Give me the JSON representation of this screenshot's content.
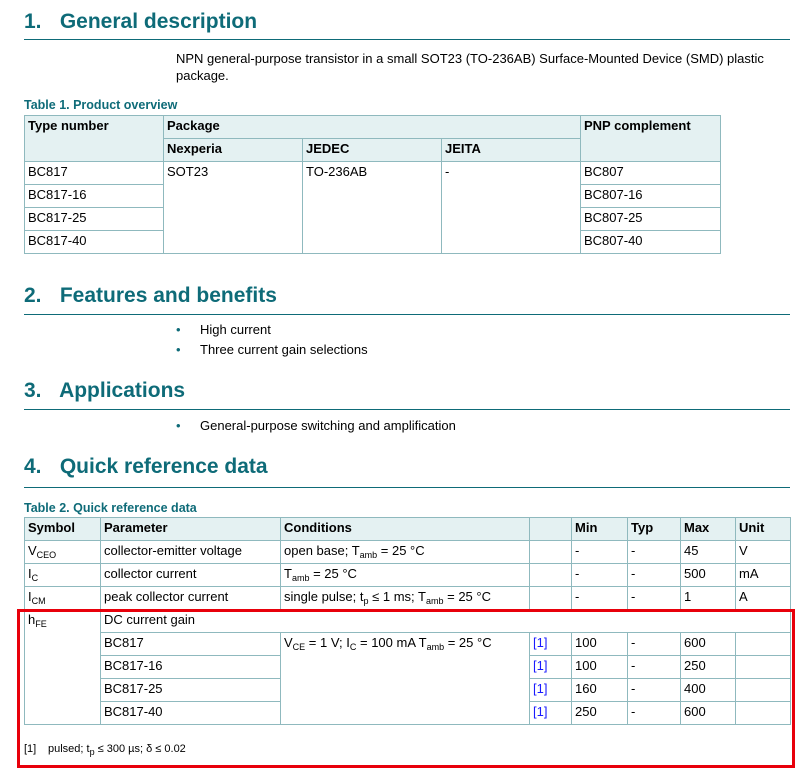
{
  "sections": [
    {
      "num": "1.",
      "title": "General description"
    },
    {
      "num": "2.",
      "title": "Features and benefits"
    },
    {
      "num": "3.",
      "title": "Applications"
    },
    {
      "num": "4.",
      "title": "Quick reference data"
    }
  ],
  "description": "NPN general-purpose transistor in a small SOT23 (TO-236AB) Surface-Mounted Device (SMD) plastic package.",
  "table1": {
    "caption": "Table 1. Product overview",
    "headers": {
      "type": "Type number",
      "package": "Package",
      "nexperia": "Nexperia",
      "jedec": "JEDEC",
      "jeita": "JEITA",
      "pnp": "PNP complement"
    },
    "package": {
      "nexperia": "SOT23",
      "jedec": "TO-236AB",
      "jeita": "-"
    },
    "rows": [
      {
        "type": "BC817",
        "pnp": "BC807"
      },
      {
        "type": "BC817-16",
        "pnp": "BC807-16"
      },
      {
        "type": "BC817-25",
        "pnp": "BC807-25"
      },
      {
        "type": "BC817-40",
        "pnp": "BC807-40"
      }
    ]
  },
  "features": [
    "High current",
    "Three current gain selections"
  ],
  "applications": [
    "General-purpose switching and amplification"
  ],
  "bullet": "•",
  "table2": {
    "caption": "Table 2. Quick reference data",
    "headers": [
      "Symbol",
      "Parameter",
      "Conditions",
      "",
      "Min",
      "Typ",
      "Max",
      "Unit"
    ],
    "rows": [
      {
        "sym": "V",
        "sym_sub": "CEO",
        "param": "collector-emitter voltage",
        "cond": [
          "open base; T",
          "amb",
          " = 25 °C"
        ],
        "min": "-",
        "typ": "-",
        "max": "45",
        "unit": "V"
      },
      {
        "sym": "I",
        "sym_sub": "C",
        "param": "collector current",
        "cond": [
          "T",
          "amb",
          " = 25 °C"
        ],
        "min": "-",
        "typ": "-",
        "max": "500",
        "unit": "mA"
      },
      {
        "sym": "I",
        "sym_sub": "CM",
        "param": "peak collector current",
        "cond": [
          "single pulse; t",
          "p",
          " ≤ 1 ms; T",
          "amb",
          " = 25 °C"
        ],
        "min": "-",
        "typ": "-",
        "max": "1",
        "unit": "A"
      }
    ],
    "hfe": {
      "sym": "h",
      "sym_sub": "FE",
      "param": "DC current gain",
      "cond": [
        "V",
        "CE",
        " = 1 V; I",
        "C",
        " = 100 mA T",
        "amb",
        " = 25 °C"
      ],
      "rows": [
        {
          "type": "BC817",
          "ref": "[1]",
          "min": "100",
          "typ": "-",
          "max": "600"
        },
        {
          "type": "BC817-16",
          "ref": "[1]",
          "min": "100",
          "typ": "-",
          "max": "250"
        },
        {
          "type": "BC817-25",
          "ref": "[1]",
          "min": "160",
          "typ": "-",
          "max": "400"
        },
        {
          "type": "BC817-40",
          "ref": "[1]",
          "min": "250",
          "typ": "-",
          "max": "600"
        }
      ]
    },
    "footnote": {
      "ref": "[1]",
      "text": [
        "pulsed; t",
        "p",
        " ≤ 300 µs; δ ≤ 0.02"
      ]
    }
  }
}
